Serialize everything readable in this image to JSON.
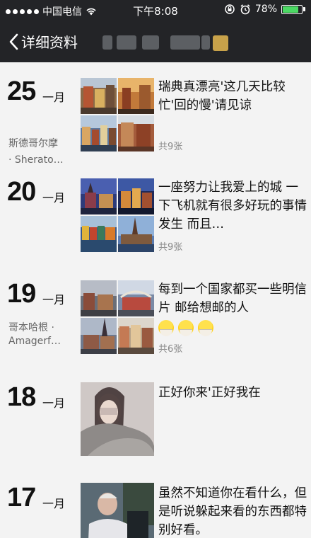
{
  "status_bar": {
    "carrier": "中国电信",
    "time": "下午8:08",
    "battery": "78%",
    "battery_level": 0.78
  },
  "nav": {
    "back_label": "详细资料"
  },
  "posts": [
    {
      "day": "25",
      "month": "一月",
      "location_line1": "斯德哥尔摩",
      "location_line2": "· Sherato…",
      "text": "瑞典真漂亮'这几天比较忙'回的慢'请见谅",
      "count": "共9张"
    },
    {
      "day": "20",
      "month": "一月",
      "text": "一座努力让我爱上的城 一下飞机就有很多好玩的事情发生  而且…",
      "count": "共9张"
    },
    {
      "day": "19",
      "month": "一月",
      "location_line1": "哥本哈根 ·",
      "location_line2": "Amagerf…",
      "text": "每到一个国家都买一些明信片 邮给想邮的人",
      "count": "共6张"
    },
    {
      "day": "18",
      "month": "一月",
      "text": "正好你来'正好我在"
    },
    {
      "day": "17",
      "month": "一月",
      "text": "虽然不知道你在看什么，但是听说躲起来看的东西都特别好看。"
    }
  ]
}
